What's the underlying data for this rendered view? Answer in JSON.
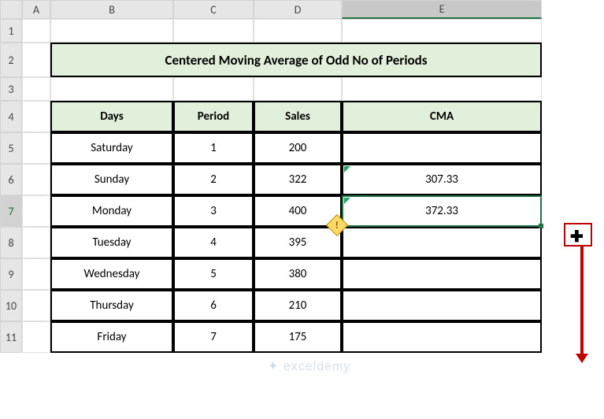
{
  "columns": [
    "A",
    "B",
    "C",
    "D",
    "E"
  ],
  "rows": [
    "1",
    "2",
    "3",
    "4",
    "5",
    "6",
    "7",
    "8",
    "9",
    "10",
    "11"
  ],
  "title": "Centered Moving Average of Odd No of Periods",
  "headers": {
    "days": "Days",
    "period": "Period",
    "sales": "Sales",
    "cma": "CMA"
  },
  "table": [
    {
      "day": "Saturday",
      "period": "1",
      "sales": "200",
      "cma": ""
    },
    {
      "day": "Sunday",
      "period": "2",
      "sales": "322",
      "cma": "307.33"
    },
    {
      "day": "Monday",
      "period": "3",
      "sales": "400",
      "cma": "372.33"
    },
    {
      "day": "Tuesday",
      "period": "4",
      "sales": "395",
      "cma": ""
    },
    {
      "day": "Wednesday",
      "period": "5",
      "sales": "380",
      "cma": ""
    },
    {
      "day": "Thursday",
      "period": "6",
      "sales": "210",
      "cma": ""
    },
    {
      "day": "Friday",
      "period": "7",
      "sales": "175",
      "cma": ""
    }
  ],
  "watermark": "exceldemy",
  "smart_tag": "!",
  "chart_data": {
    "type": "table",
    "title": "Centered Moving Average of Odd No of Periods",
    "columns": [
      "Days",
      "Period",
      "Sales",
      "CMA"
    ],
    "rows": [
      [
        "Saturday",
        1,
        200,
        null
      ],
      [
        "Sunday",
        2,
        322,
        307.33
      ],
      [
        "Monday",
        3,
        400,
        372.33
      ],
      [
        "Tuesday",
        4,
        395,
        null
      ],
      [
        "Wednesday",
        5,
        380,
        null
      ],
      [
        "Thursday",
        6,
        210,
        null
      ],
      [
        "Friday",
        7,
        175,
        null
      ]
    ]
  }
}
